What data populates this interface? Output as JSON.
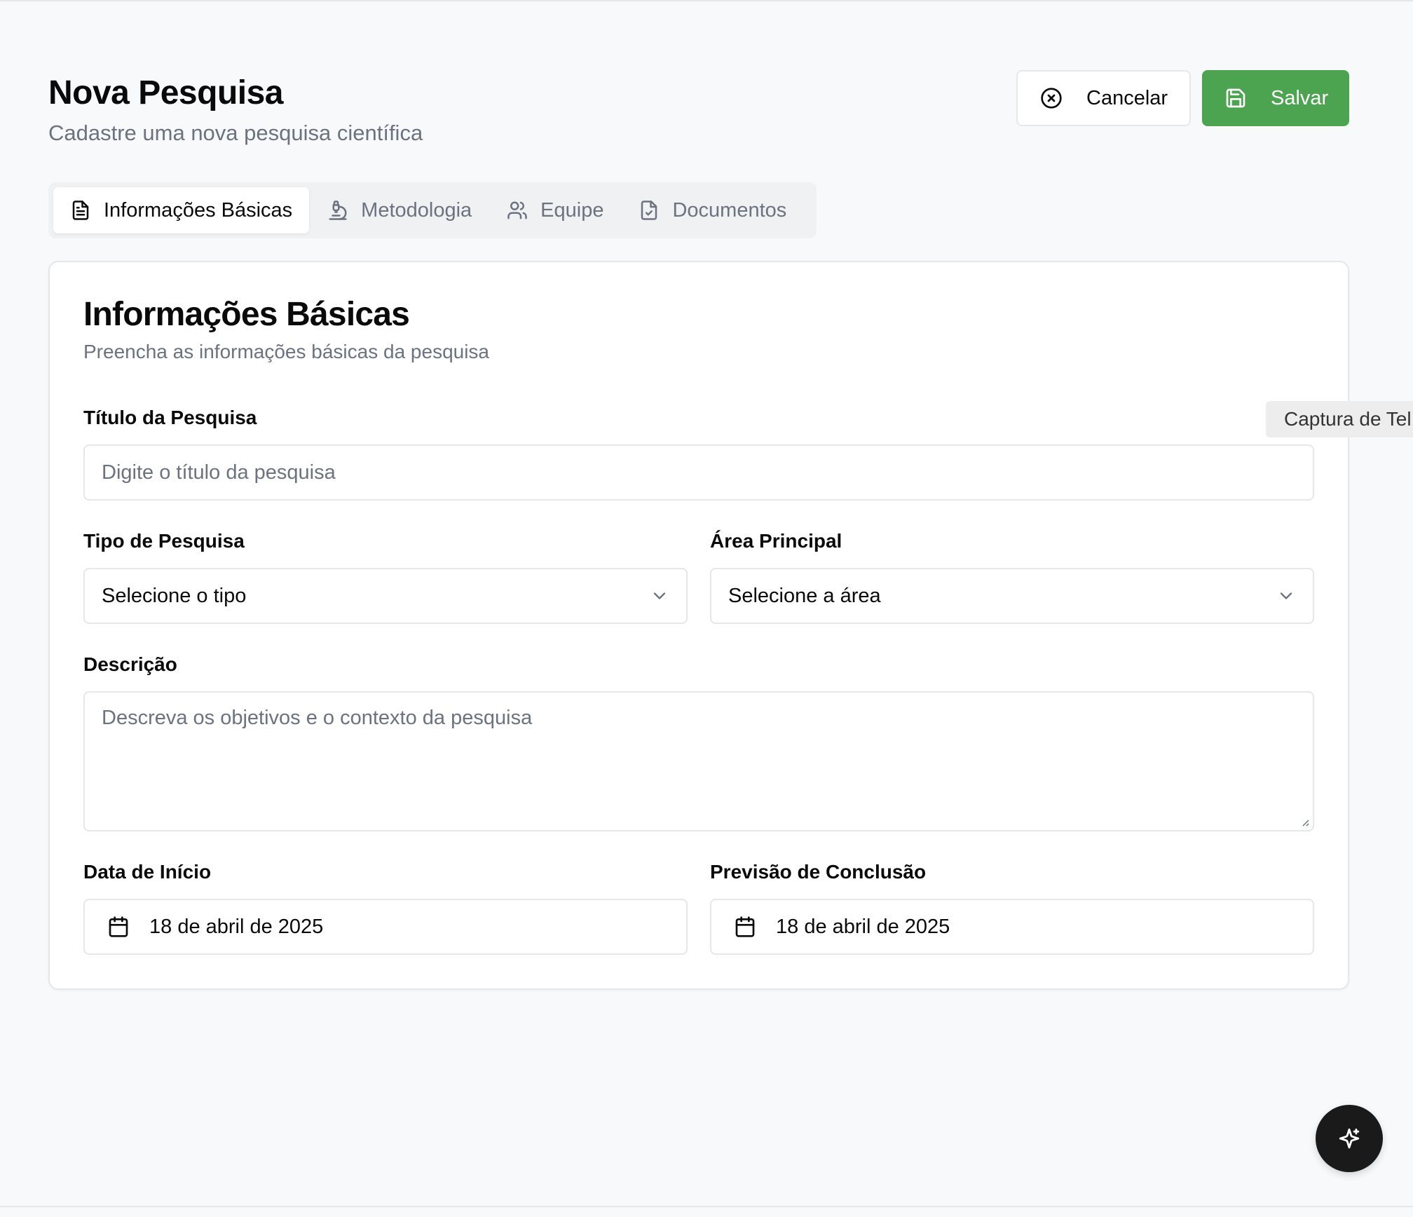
{
  "header": {
    "title": "Nova Pesquisa",
    "subtitle": "Cadastre uma nova pesquisa científica"
  },
  "actions": {
    "cancel_label": "Cancelar",
    "save_label": "Salvar"
  },
  "tabs": [
    {
      "label": "Informações Básicas",
      "icon": "file-text-icon",
      "active": true
    },
    {
      "label": "Metodologia",
      "icon": "microscope-icon",
      "active": false
    },
    {
      "label": "Equipe",
      "icon": "users-icon",
      "active": false
    },
    {
      "label": "Documentos",
      "icon": "file-check-icon",
      "active": false
    }
  ],
  "card": {
    "title": "Informações Básicas",
    "subtitle": "Preencha as informações básicas da pesquisa"
  },
  "form": {
    "title_label": "Título da Pesquisa",
    "title_placeholder": "Digite o título da pesquisa",
    "type_label": "Tipo de Pesquisa",
    "type_value": "Selecione o tipo",
    "area_label": "Área Principal",
    "area_value": "Selecione a área",
    "description_label": "Descrição",
    "description_placeholder": "Descreva os objetivos e o contexto da pesquisa",
    "start_label": "Data de Início",
    "start_value": "18 de abril de 2025",
    "end_label": "Previsão de Conclusão",
    "end_value": "18 de abril de 2025"
  },
  "tooltip": {
    "text": "Captura de Tel"
  },
  "fab": {
    "icon": "sparkles-icon"
  },
  "colors": {
    "primary_green": "#4ca350",
    "fab_background": "#1a1a1a",
    "muted_text": "#6b7280",
    "border": "#e5e7eb"
  }
}
